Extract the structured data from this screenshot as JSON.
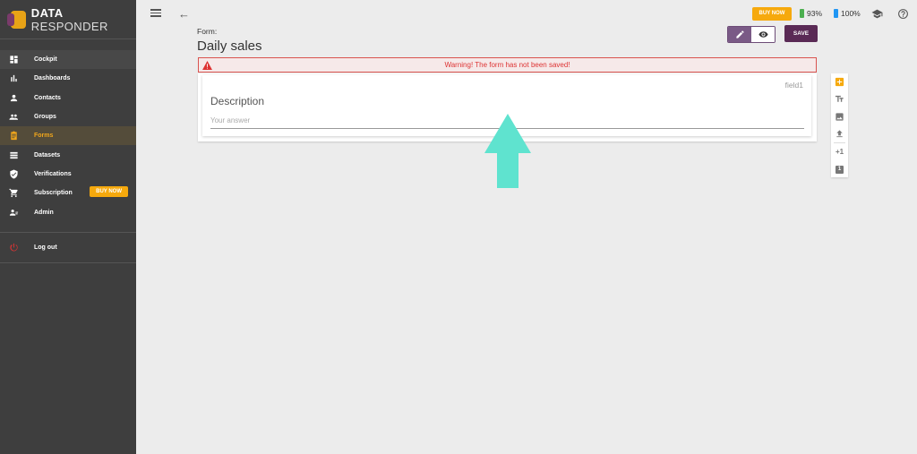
{
  "brand": {
    "bold": "DATA",
    "light": "RESPONDER"
  },
  "sidebar": {
    "items": [
      {
        "label": "Cockpit",
        "icon": "dashboard-icon"
      },
      {
        "label": "Dashboards",
        "icon": "bar-chart-icon"
      },
      {
        "label": "Contacts",
        "icon": "person-icon"
      },
      {
        "label": "Groups",
        "icon": "group-icon"
      },
      {
        "label": "Forms",
        "icon": "clipboard-icon"
      },
      {
        "label": "Datasets",
        "icon": "list-icon"
      },
      {
        "label": "Verifications",
        "icon": "shield-check-icon"
      },
      {
        "label": "Subscription",
        "icon": "cart-icon"
      },
      {
        "label": "Admin",
        "icon": "admin-icon"
      }
    ],
    "subscription_buy": "BUY NOW",
    "logout": "Log out"
  },
  "topbar": {
    "buy_now": "BUY NOW",
    "stat1": "93%",
    "stat2": "100%",
    "colors": {
      "stat1": "#4caf50",
      "stat2": "#2196f3"
    }
  },
  "header": {
    "form_label": "Form:",
    "title": "Daily sales",
    "save": "SAVE"
  },
  "warning": "Warning! The form has not been saved!",
  "field": {
    "id": "field1",
    "description": "Description",
    "placeholder": "Your answer"
  },
  "toolbar": {
    "plus_one": "+1",
    "badge": "1"
  },
  "colors": {
    "accent": "#f6a90d",
    "primary": "#5a2a55",
    "sidebar": "#3e3e3e",
    "arrow": "#5fe3cf"
  }
}
